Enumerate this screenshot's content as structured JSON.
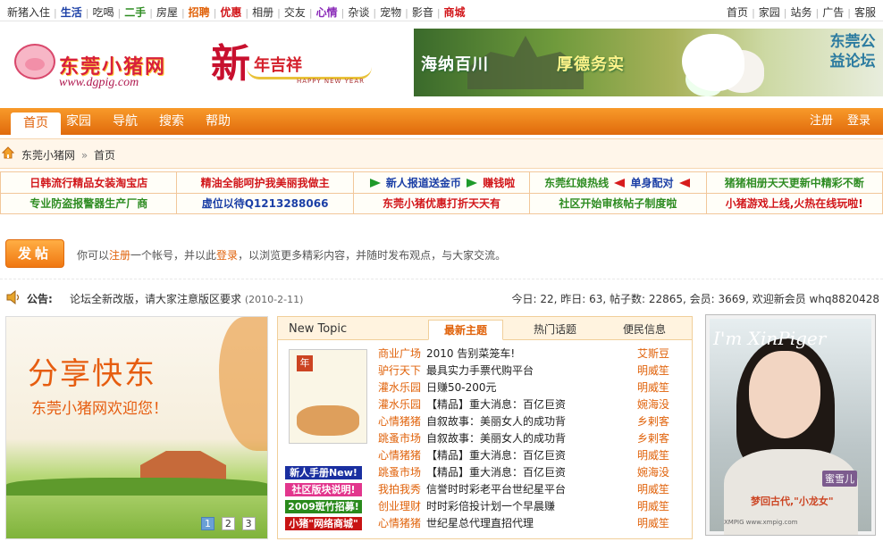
{
  "topnav": {
    "left": [
      {
        "label": "新猪入住",
        "color": "#333333"
      },
      {
        "label": "生活",
        "color": "#1b3fa6"
      },
      {
        "label": "吃喝",
        "color": "#333333"
      },
      {
        "label": "二手",
        "color": "#2e8c22"
      },
      {
        "label": "房屋",
        "color": "#333333"
      },
      {
        "label": "招聘",
        "color": "#e0620a"
      },
      {
        "label": "优惠",
        "color": "#d2171b"
      },
      {
        "label": "相册",
        "color": "#333333"
      },
      {
        "label": "交友",
        "color": "#333333"
      },
      {
        "label": "心情",
        "color": "#8a2ab8"
      },
      {
        "label": "杂谈",
        "color": "#333333"
      },
      {
        "label": "宠物",
        "color": "#333333"
      },
      {
        "label": "影音",
        "color": "#333333"
      },
      {
        "label": "商城",
        "color": "#d2171b"
      }
    ],
    "right": [
      "首页",
      "家园",
      "站务",
      "广告",
      "客服"
    ]
  },
  "header": {
    "logo_text": "东莞小猪网",
    "logo_url": "www.dgpig.com",
    "newyear_big": "新",
    "newyear_sub": "年吉祥",
    "newyear_en": "HAPPY NEW YEAR",
    "banner_left": "海纳百川",
    "banner_mid": "厚德务实",
    "banner_right": "东莞公益论坛"
  },
  "mainnav": {
    "items": [
      "首页",
      "家园",
      "导航",
      "搜索",
      "帮助"
    ],
    "right": [
      "注册",
      "登录"
    ]
  },
  "breadcrumb": {
    "site": "东莞小猪网",
    "sep": "»",
    "page": "首页"
  },
  "ads": {
    "row1": [
      {
        "text": "日韩流行精品女装淘宝店",
        "cls": "c-red"
      },
      {
        "text": "精油全能呵护我美丽我做主",
        "cls": "c-red"
      },
      {
        "pre": "",
        "text": "新人报道送金币",
        "post": "赚钱啦",
        "cls": "c-blue",
        "arrows": "g"
      },
      {
        "pre": "东莞红娘热线",
        "text": "单身配对",
        "post": "",
        "cls": "c-green",
        "arrows": "r"
      },
      {
        "text": "猪猪相册天天更新中精彩不断",
        "cls": "c-green"
      }
    ],
    "row2": [
      {
        "text": "专业防盗报警器生产厂商",
        "cls": "c-green"
      },
      {
        "text": "虚位以待Q1213288066",
        "cls": "c-blue"
      },
      {
        "text": "东莞小猪优惠打折天天有",
        "cls": "c-red"
      },
      {
        "text": "社区开始审核帖子制度啦",
        "cls": "c-green"
      },
      {
        "text": "小猪游戏上线,火热在线玩啦!",
        "cls": "c-red"
      }
    ]
  },
  "post": {
    "button": "发帖",
    "msg_pre": "你可以",
    "msg_reg": "注册",
    "msg_mid": "一个帐号，并以此",
    "msg_login": "登录",
    "msg_post": "，以浏览更多精彩内容，并随时发布观点，与大家交流。"
  },
  "announce": {
    "label": "公告:",
    "text": "论坛全新改版，请大家注意版区要求",
    "date": "(2010-2-11)",
    "stats": "今日: 22, 昨日: 63, 帖子数: 22865, 会员: 3669, 欢迎新会员 whq8820428"
  },
  "slide": {
    "headline": "分享快东",
    "subline": "东莞小猪网欢迎您！",
    "pages": [
      "1",
      "2",
      "3"
    ],
    "active_page": 0
  },
  "topics": {
    "panel_title": "New Topic",
    "tabs": [
      "最新主题",
      "热门话题",
      "便民信息"
    ],
    "active_tab": 0,
    "calendar_label": "年",
    "tags": [
      {
        "text": "新人手册New!",
        "bg": "#1a2fa0"
      },
      {
        "text": "社区版块说明!",
        "bg": "#e2368d"
      },
      {
        "text": "2009斑竹招募!",
        "bg": "#2a8a1c"
      },
      {
        "text": "小猪\"网络商城\"",
        "bg": "#c81414"
      }
    ],
    "rows": [
      {
        "forum": "商业广场",
        "title": "2010 告别菜笼车!",
        "user": "艾斯豆"
      },
      {
        "forum": "驴行天下",
        "title": "最具实力手票代购平台",
        "user": "明威笙"
      },
      {
        "forum": "灌水乐园",
        "title": "日赚50-200元",
        "user": "明威笙"
      },
      {
        "forum": "灌水乐园",
        "title": "【精品】重大消息：百亿巨资",
        "user": "婉海没"
      },
      {
        "forum": "心情猪猪",
        "title": "自叙故事：美丽女人的成功背",
        "user": "乡剌客"
      },
      {
        "forum": "跳蚤市场",
        "title": "自叙故事：美丽女人的成功背",
        "user": "乡剌客"
      },
      {
        "forum": "心情猪猪",
        "title": "【精品】重大消息：百亿巨资",
        "user": "明威笙"
      },
      {
        "forum": "跳蚤市场",
        "title": "【精品】重大消息：百亿巨资",
        "user": "婉海没"
      },
      {
        "forum": "我拍我秀",
        "title": "信誉时时彩老平台世纪星平台",
        "user": "明威笙"
      },
      {
        "forum": "创业理财",
        "title": "时时彩倍投计划一个早晨赚",
        "user": "明威笙"
      },
      {
        "forum": "心情猪猪",
        "title": "世纪星总代理直招代理",
        "user": "明威笙"
      }
    ]
  },
  "photo": {
    "logo": "I'm XinPiger",
    "name": "蜜雪儿",
    "caption": "梦回古代,\"小龙女\"",
    "source": "XMPIG  www.xmpig.com"
  }
}
